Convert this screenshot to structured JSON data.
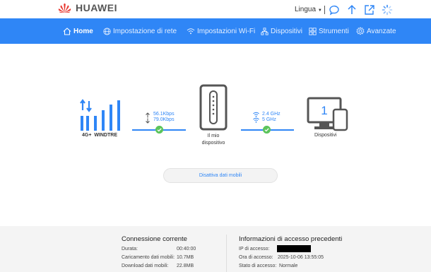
{
  "header": {
    "brand": "HUAWEI",
    "language_label": "Lingua",
    "icons": [
      "message-icon",
      "upload-icon",
      "logout-icon",
      "loading-icon"
    ]
  },
  "nav": {
    "items": [
      {
        "label": "Home",
        "icon": "home-icon",
        "active": true
      },
      {
        "label": "Impostazione di rete",
        "icon": "globe-icon",
        "active": false
      },
      {
        "label": "Impostazioni Wi-Fi",
        "icon": "wifi-icon",
        "active": false
      },
      {
        "label": "Dispositivi",
        "icon": "network-icon",
        "active": false
      },
      {
        "label": "Strumenti",
        "icon": "tools-icon",
        "active": false
      },
      {
        "label": "Avanzate",
        "icon": "gear-icon",
        "active": false
      }
    ]
  },
  "status": {
    "network_type": "4G+",
    "carrier": "WINDTRE",
    "upload_rate": "56.1Kbps",
    "download_rate": "79.0Kbps",
    "device_label_line1": "Il mio",
    "device_label_line2": "dispositivo",
    "band_24": "2.4 GHz",
    "band_5": "5 GHz",
    "devices_count": "1",
    "devices_label": "Dispositivi"
  },
  "actions": {
    "mobile_data_button": "Disattiva dati mobili"
  },
  "current_connection": {
    "title": "Connessione corrente",
    "rows": [
      {
        "key": "Durata:",
        "value": "00:40:00"
      },
      {
        "key": "Caricamento dati mobili:",
        "value": "10.7MB"
      },
      {
        "key": "Download dati mobili:",
        "value": "22.8MB"
      }
    ]
  },
  "previous_access": {
    "title": "Informazioni di accesso precedenti",
    "rows": [
      {
        "key": "IP di accesso:",
        "value": ""
      },
      {
        "key": "Ora di accesso:",
        "value": "2025-10-06 13:55:05"
      },
      {
        "key": "Stato di accesso:",
        "value": "Normale"
      }
    ]
  },
  "colors": {
    "accent": "#2f86f6",
    "ok": "#5cc45c"
  }
}
